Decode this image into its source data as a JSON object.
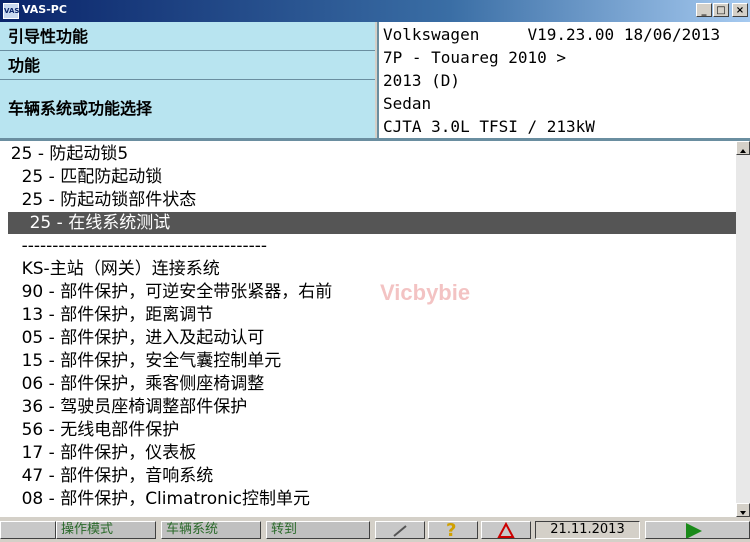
{
  "window": {
    "title": "VAS-PC",
    "icon_text": "VAS",
    "minimize_glyph": "_",
    "maximize_glyph": "□",
    "close_glyph": "×"
  },
  "header": {
    "left": {
      "row1": "引导性功能",
      "row2": "功能",
      "row3": "车辆系统或功能选择"
    },
    "right": {
      "line1": "Volkswagen     V19.23.00 18/06/2013",
      "line2": "7P - Touareg 2010 >",
      "line3": "2013 (D)",
      "line4": "Sedan",
      "line5": "CJTA 3.0L TFSI / 213kW"
    }
  },
  "list": {
    "items": [
      "  25 - 防起动锁5",
      "    25 - 匹配防起动锁",
      "    25 - 防起动锁部件状态",
      "    25 - 在线系统测试",
      "    ----------------------------------------",
      "    KS-主站（网关）连接系统",
      "    90 - 部件保护，可逆安全带张紧器，右前",
      "    13 - 部件保护，距离调节",
      "    05 - 部件保护，进入及起动认可",
      "    15 - 部件保护，安全气囊控制单元",
      "    06 - 部件保护，乘客侧座椅调整",
      "    36 - 驾驶员座椅调整部件保护",
      "    56 - 无线电部件保护",
      "    17 - 部件保护，仪表板",
      "    47 - 部件保护，音响系统",
      "    08 - 部件保护，Climatronic控制单元"
    ],
    "selected_index": 3,
    "watermark": "Vicbybie"
  },
  "toolbar": {
    "btn1": "操作模式",
    "btn2": "车辆系统",
    "btn3": "转到",
    "date": "21.11.2013",
    "help_glyph": "?",
    "accent": "#2a6a2a"
  }
}
